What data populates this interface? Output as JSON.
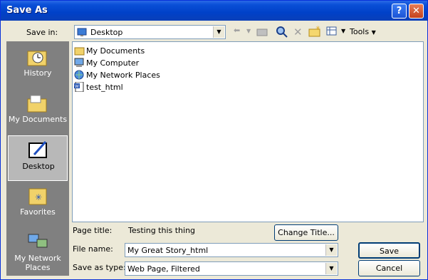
{
  "window": {
    "title": "Save As"
  },
  "save_in": {
    "label": "Save in:",
    "value": "Desktop"
  },
  "toolbar": {
    "tools_label": "Tools"
  },
  "places": [
    {
      "label": "History",
      "icon": "history-icon"
    },
    {
      "label": "My Documents",
      "icon": "my-documents-icon"
    },
    {
      "label": "Desktop",
      "icon": "desktop-icon",
      "selected": true
    },
    {
      "label": "Favorites",
      "icon": "favorites-icon"
    },
    {
      "label": "My Network Places",
      "icon": "network-places-icon"
    }
  ],
  "files": [
    {
      "name": "My Documents",
      "icon": "folder-icon"
    },
    {
      "name": "My Computer",
      "icon": "computer-icon"
    },
    {
      "name": "My Network Places",
      "icon": "network-icon"
    },
    {
      "name": "test_html",
      "icon": "word-doc-icon"
    }
  ],
  "page_title": {
    "label": "Page title:",
    "value": "Testing this thing",
    "change_button": "Change Title..."
  },
  "file_name": {
    "label": "File name:",
    "value": "My Great Story_html"
  },
  "save_as_type": {
    "label": "Save as type:",
    "value": "Web Page, Filtered"
  },
  "buttons": {
    "save": "Save",
    "cancel": "Cancel"
  }
}
